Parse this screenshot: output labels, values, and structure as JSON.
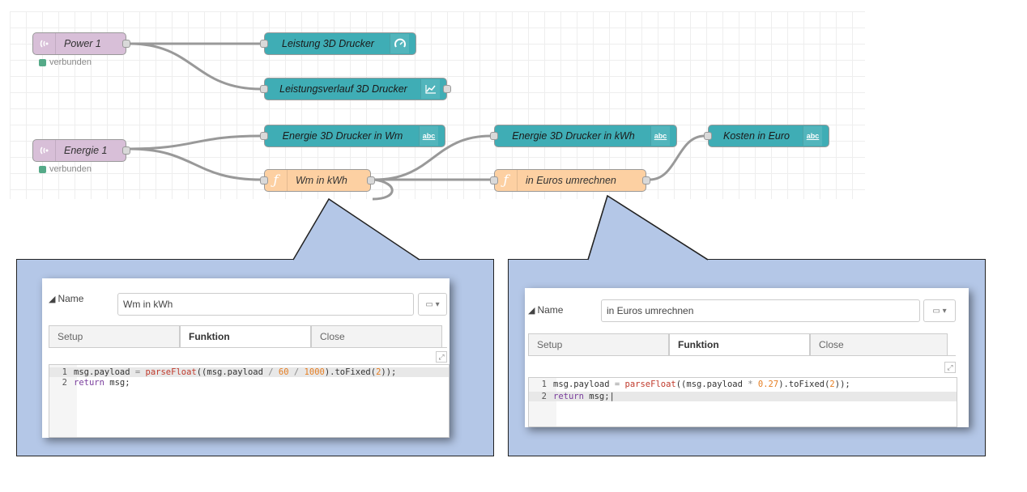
{
  "flow": {
    "nodes": {
      "power1": {
        "label": "Power 1",
        "status": "verbunden"
      },
      "energie1": {
        "label": "Energie 1",
        "status": "verbunden"
      },
      "leistung": {
        "label": "Leistung 3D Drucker"
      },
      "leistungsverlauf": {
        "label": "Leistungsverlauf 3D Drucker"
      },
      "energie_wm": {
        "label": "Energie 3D Drucker in Wm"
      },
      "wm_kwh": {
        "label": "Wm in kWh"
      },
      "energie_kwh": {
        "label": "Energie 3D Drucker in kWh"
      },
      "euros": {
        "label": "in Euros umrechnen"
      },
      "kosten": {
        "label": "Kosten in Euro"
      }
    },
    "icons": {
      "abc": "abc"
    }
  },
  "dialogs": [
    {
      "name_label": "Name",
      "name_value": "Wm in kWh",
      "tabs": [
        "Setup",
        "Funktion",
        "Close"
      ],
      "active_tab": "Funktion",
      "code_lines": [
        {
          "no": "1",
          "text": "msg.payload = parseFloat((msg.payload / 60 / 1000).toFixed(2));"
        },
        {
          "no": "2",
          "text": "return msg;"
        }
      ]
    },
    {
      "name_label": "Name",
      "name_value": "in Euros umrechnen",
      "tabs": [
        "Setup",
        "Funktion",
        "Close"
      ],
      "active_tab": "Funktion",
      "code_lines": [
        {
          "no": "1",
          "text": "msg.payload = parseFloat((msg.payload * 0.27).toFixed(2));"
        },
        {
          "no": "2",
          "text": "return msg;"
        }
      ]
    }
  ],
  "colors": {
    "inject": "#d8bfd8",
    "dashboard": "#3fadb5",
    "function": "#fdd0a2",
    "callout": "#b4c7e7"
  }
}
